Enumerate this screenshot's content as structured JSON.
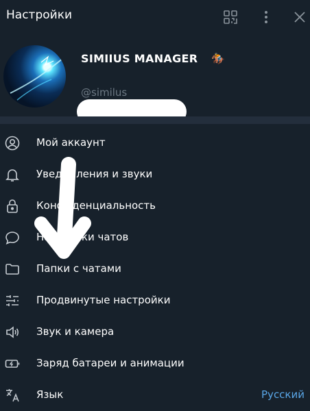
{
  "header": {
    "title": "Настройки"
  },
  "profile": {
    "name": "SIMIIUS MANAGER",
    "name_emoji": "🏇",
    "username": "@similus"
  },
  "menu": {
    "items": [
      {
        "label": "Мой аккаунт",
        "icon": "person-icon"
      },
      {
        "label": "Уведомления и звуки",
        "icon": "bell-icon"
      },
      {
        "label": "Конфиденциальность",
        "icon": "lock-icon"
      },
      {
        "label": "Настройки чатов",
        "icon": "chat-bubble-icon"
      },
      {
        "label": "Папки с чатами",
        "icon": "folder-icon"
      },
      {
        "label": "Продвинутые настройки",
        "icon": "sliders-icon"
      },
      {
        "label": "Звук и камера",
        "icon": "speaker-icon"
      },
      {
        "label": "Заряд батареи и анимации",
        "icon": "battery-icon"
      },
      {
        "label": "Язык",
        "icon": "language-icon",
        "value": "Русский"
      }
    ]
  },
  "colors": {
    "background": "#17212b",
    "divider": "#232e3c",
    "muted_text": "#6c7883",
    "icon": "#c7cdd3",
    "accent": "#5aa7e8"
  }
}
